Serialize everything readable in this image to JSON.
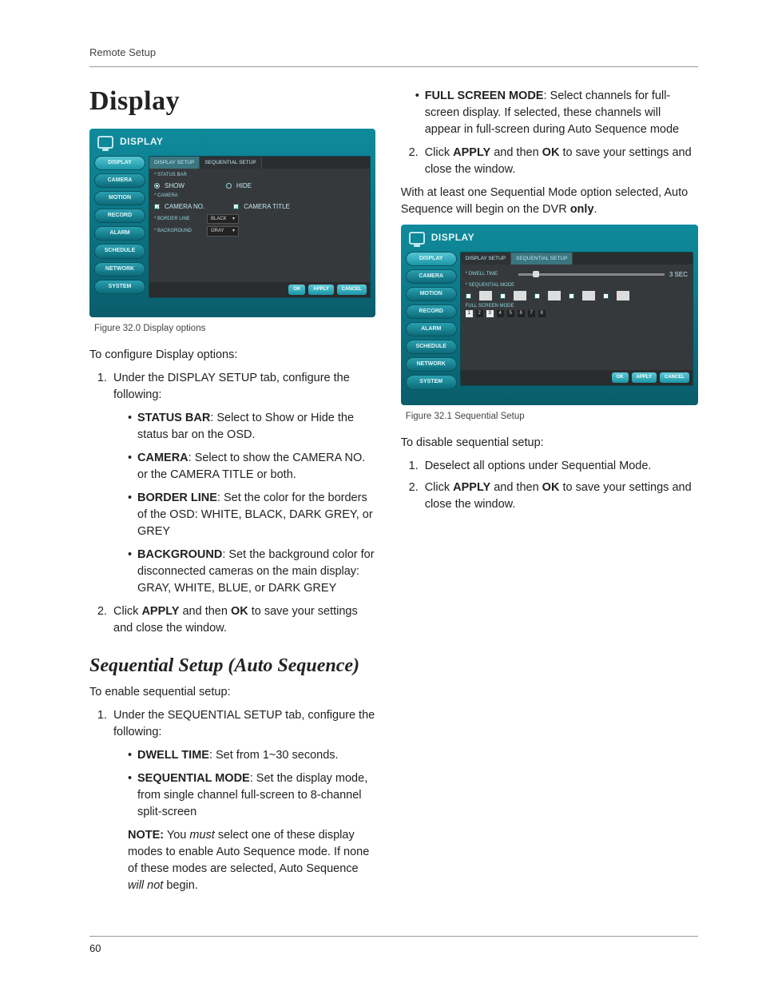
{
  "header": {
    "section": "Remote Setup"
  },
  "footer": {
    "page": "60"
  },
  "left": {
    "h1": "Display",
    "fig1_caption": "Figure 32.0 Display options",
    "intro": "To configure Display options:",
    "step1": "Under the DISPLAY SETUP tab, configure the following:",
    "bullets": {
      "status_bar_b": "STATUS BAR",
      "status_bar_t": ": Select to Show or Hide the status bar on the OSD.",
      "camera_b": "CAMERA",
      "camera_t": ": Select to show the CAMERA NO. or the CAMERA TITLE or both.",
      "border_b": "BORDER LINE",
      "border_t": ": Set the color for the borders of the OSD: WHITE, BLACK, DARK GREY, or GREY",
      "bg_b": "BACKGROUND",
      "bg_t": ": Set the background color for disconnected cameras on the main display: GRAY, WHITE, BLUE, or DARK GREY"
    },
    "step2_a": "Click ",
    "step2_apply": "APPLY",
    "step2_b": " and then ",
    "step2_ok": "OK",
    "step2_c": " to save your settings and close the window.",
    "h2": "Sequential Setup (Auto Sequence)",
    "seq_intro": "To enable sequential setup:",
    "seq_step1": "Under the SEQUENTIAL SETUP tab, configure the following:",
    "seq_bullets": {
      "dwell_b": "DWELL TIME",
      "dwell_t": ": Set from 1~30 seconds.",
      "mode_b": "SEQUENTIAL MODE",
      "mode_t": ": Set the display mode, from single channel full-screen to 8-channel split-screen"
    },
    "note_label": "NOTE:",
    "note_a": " You ",
    "note_must": "must",
    "note_b": " select one of these display modes to enable Auto Sequence mode. If none of these modes are selected, Auto Sequence ",
    "note_willnot": "will not",
    "note_c": " begin."
  },
  "right": {
    "bullets": {
      "fsm_b": "FULL SCREEN MODE",
      "fsm_t": ": Select channels for full-screen display. If selected, these channels will appear in full-screen during Auto Sequence mode"
    },
    "step2_a": "Click ",
    "step2_apply": "APPLY",
    "step2_b": " and then ",
    "step2_ok": "OK",
    "step2_c": " to save your settings and close the window.",
    "para_a": "With at least one Sequential Mode option selected, Auto Sequence will begin on the DVR ",
    "para_only": "only",
    "para_b": ".",
    "fig2_caption": "Figure 32.1 Sequential Setup",
    "disable_intro": "To disable sequential setup:",
    "dstep1": "Deselect all options under Sequential Mode.",
    "dstep2_a": "Click ",
    "dstep2_apply": "APPLY",
    "dstep2_b": " and then ",
    "dstep2_ok": "OK",
    "dstep2_c": " to save your settings and close the window."
  },
  "ui": {
    "title": "DISPLAY",
    "nav": [
      "DISPLAY",
      "CAMERA",
      "MOTION",
      "RECORD",
      "ALARM",
      "SCHEDULE",
      "NETWORK",
      "SYSTEM"
    ],
    "tabs_a": [
      "DISPLAY SETUP",
      "SEQUENTIAL SETUP"
    ],
    "panelA": {
      "status_bar": "* STATUS BAR",
      "show": "SHOW",
      "hide": "HIDE",
      "camera": "* CAMERA",
      "cam_no": "CAMERA NO.",
      "cam_title": "CAMERA TITLE",
      "border": "* BORDER LINE",
      "border_val": "BLACK",
      "bg": "* BACKGROUND",
      "bg_val": "GRAY"
    },
    "panelB": {
      "dwell": "* DWELL TIME",
      "dwell_val": "3 SEC",
      "seqmode": "* SEQUENTIAL MODE",
      "fsm": "FULL SCREEN MODE"
    },
    "btns": {
      "ok": "OK",
      "apply": "APPLY",
      "cancel": "CANCEL"
    }
  }
}
